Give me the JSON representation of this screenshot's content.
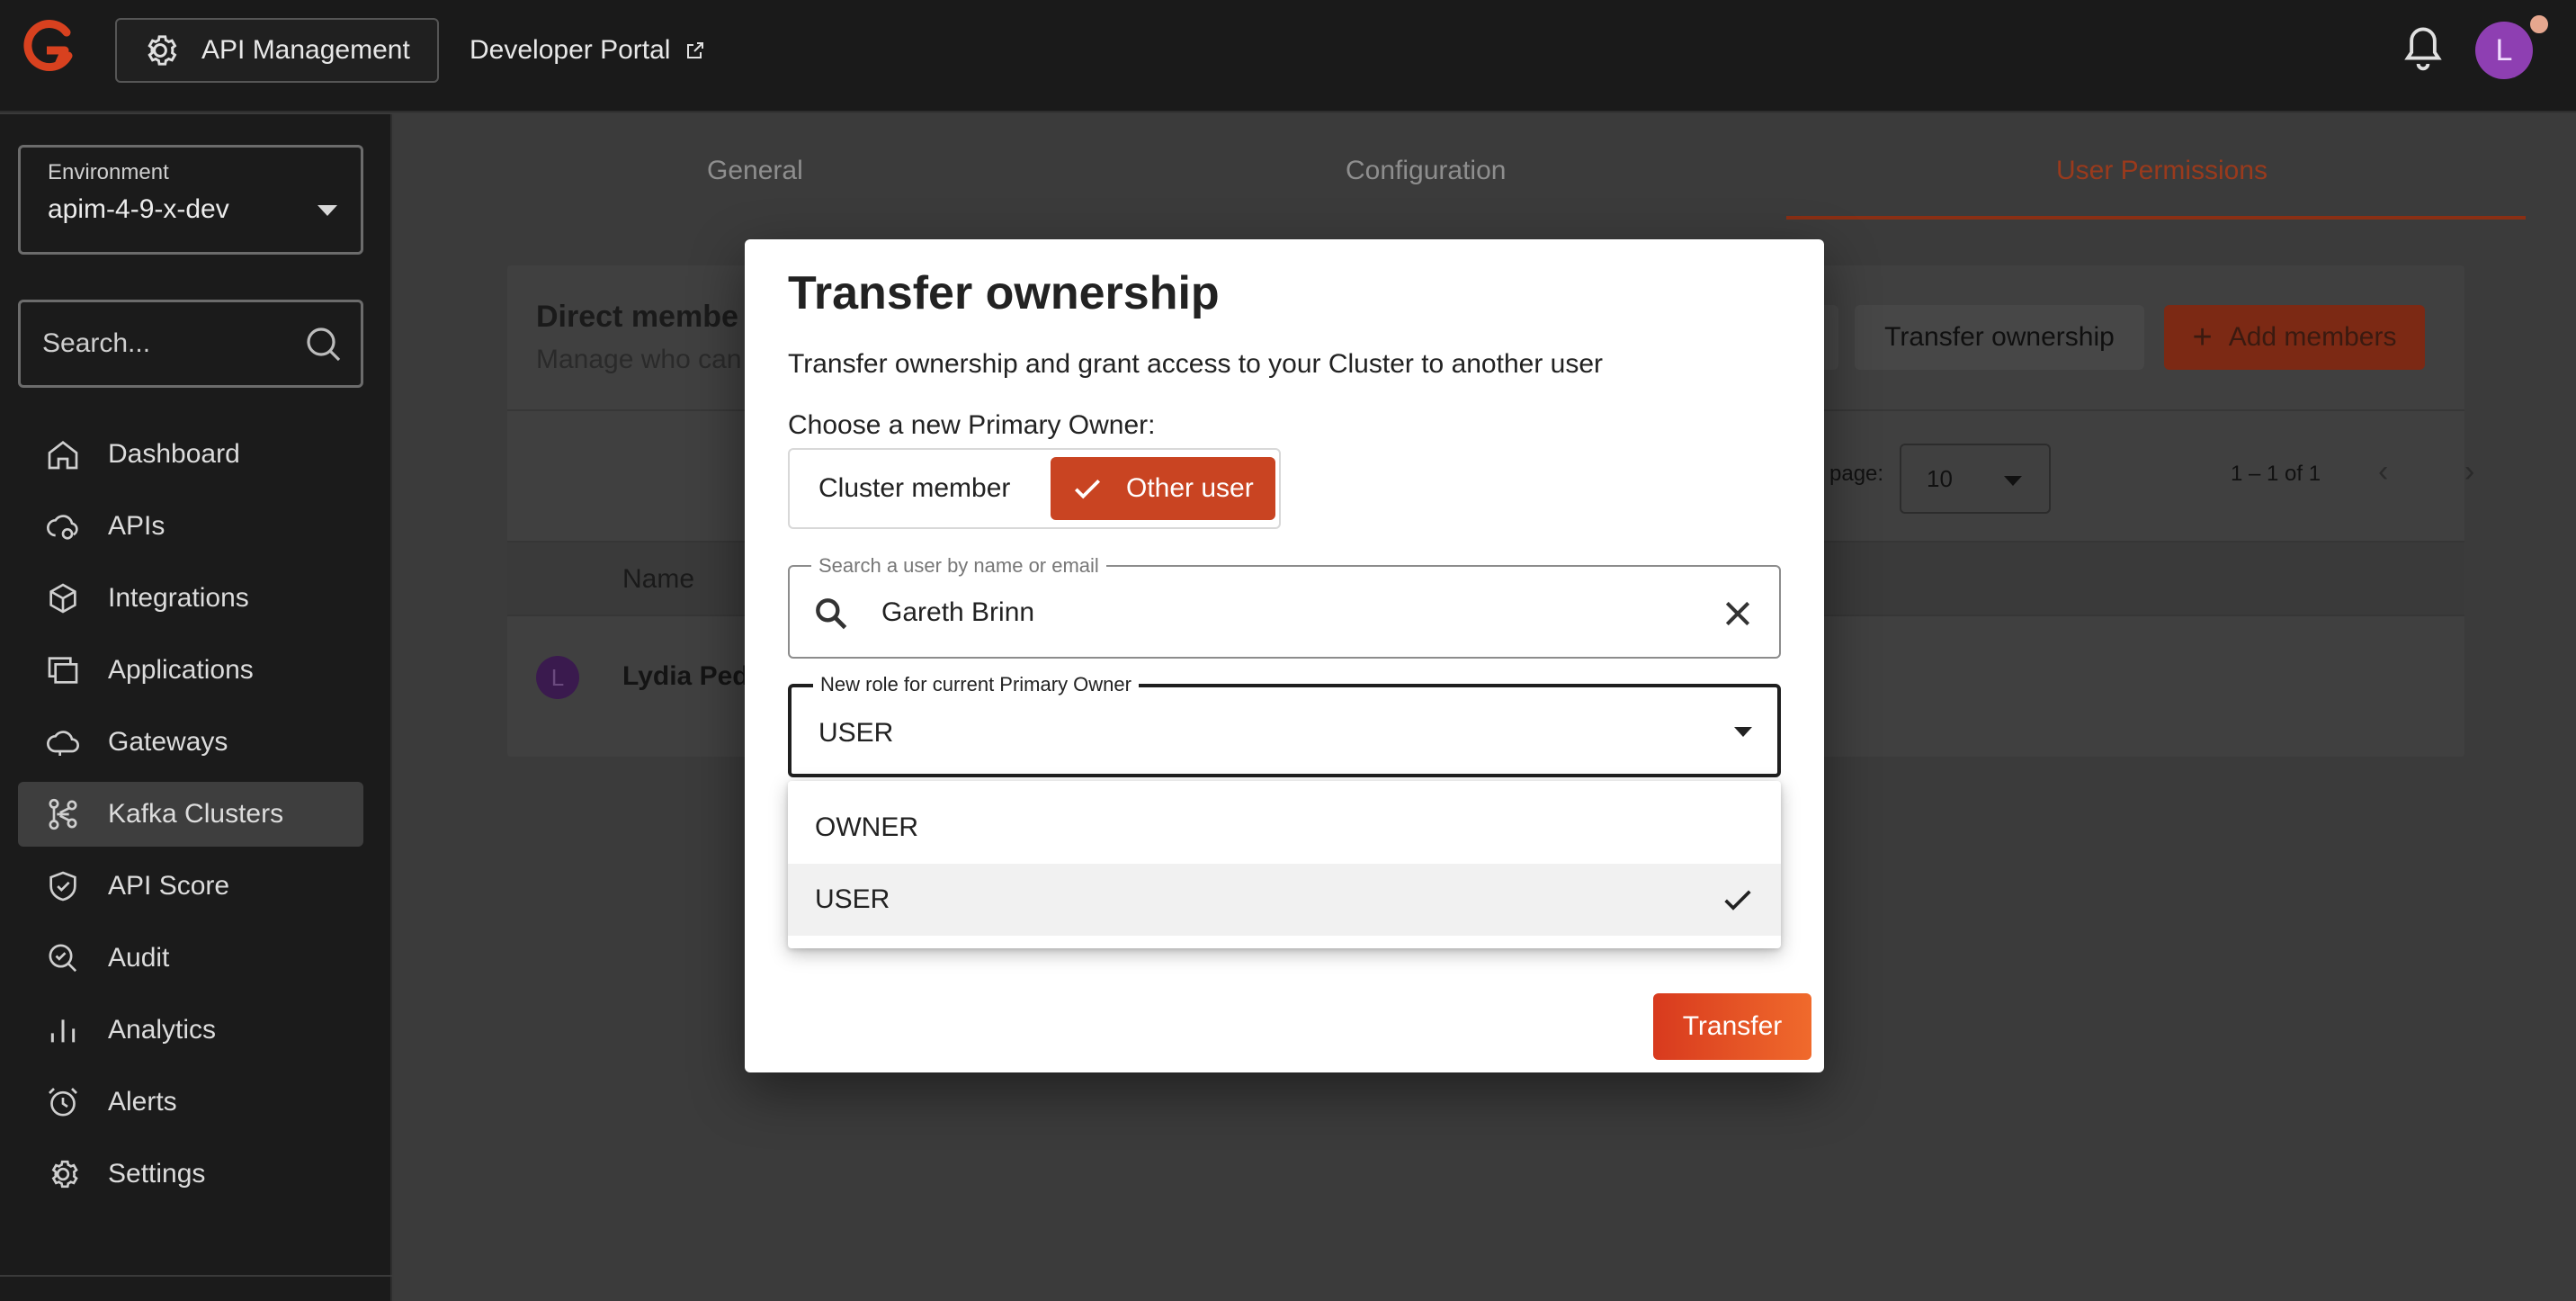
{
  "topbar": {
    "api_management_label": "API Management",
    "developer_portal_label": "Developer Portal",
    "avatar_initial": "L"
  },
  "sidebar": {
    "environment_label": "Environment",
    "environment_value": "apim-4-9-x-dev",
    "search_placeholder": "Search...",
    "items": [
      {
        "label": "Dashboard",
        "icon": "home-icon"
      },
      {
        "label": "APIs",
        "icon": "cloud-gear-icon"
      },
      {
        "label": "Integrations",
        "icon": "cube-icon"
      },
      {
        "label": "Applications",
        "icon": "windows-icon"
      },
      {
        "label": "Gateways",
        "icon": "cloud-icon"
      },
      {
        "label": "Kafka Clusters",
        "icon": "kafka-icon",
        "active": true
      },
      {
        "label": "API Score",
        "icon": "shield-check-icon"
      },
      {
        "label": "Audit",
        "icon": "search-check-icon"
      },
      {
        "label": "Analytics",
        "icon": "bar-chart-icon"
      },
      {
        "label": "Alerts",
        "icon": "alarm-icon"
      },
      {
        "label": "Settings",
        "icon": "gear-icon"
      }
    ]
  },
  "main": {
    "tabs": [
      {
        "label": "General"
      },
      {
        "label": "Configuration"
      },
      {
        "label": "User Permissions",
        "active": true
      }
    ],
    "card": {
      "title": "Direct membe",
      "subtitle": "Manage who can",
      "transfer_button": "Transfer ownership",
      "add_button": "Add members",
      "per_page_label": "page:",
      "per_page_value": "10",
      "range": "1 – 1 of 1",
      "column_name": "Name",
      "rows": [
        {
          "initial": "L",
          "name": "Lydia Pede"
        }
      ]
    }
  },
  "dialog": {
    "title": "Transfer ownership",
    "description": "Transfer ownership and grant access to your Cluster to another user",
    "choose_label": "Choose a new Primary Owner:",
    "toggle": {
      "option1": "Cluster member",
      "option2": "Other user",
      "selected": "Other user"
    },
    "search": {
      "label": "Search a user by name or email",
      "value": "Gareth Brinn"
    },
    "role": {
      "label": "New role for current Primary Owner",
      "value": "USER"
    },
    "submit_label": "Transfer",
    "menu": {
      "options": [
        "OWNER",
        "USER"
      ],
      "selected": "USER"
    }
  },
  "colors": {
    "accent": "#c94422",
    "button_gradient_end": "#f06a2c",
    "avatar": "#8e3fb2"
  }
}
